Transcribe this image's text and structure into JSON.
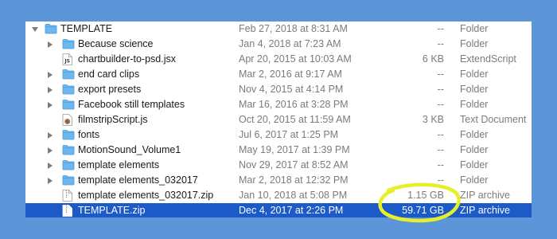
{
  "colors": {
    "background": "#5c96d8",
    "selection": "#1c5ac8",
    "folder": "#6cb7ee",
    "highlight_ring": "#e7ef2a"
  },
  "rows": [
    {
      "name": "TEMPLATE",
      "date": "Feb 27, 2018 at 8:31 AM",
      "size": "--",
      "kind": "Folder",
      "icon": "folder-icon",
      "disclosure": "open"
    },
    {
      "name": "Because science",
      "date": "Jan 4, 2018 at 7:23 AM",
      "size": "--",
      "kind": "Folder",
      "icon": "folder-icon",
      "disclosure": "closed"
    },
    {
      "name": "chartbuilder-to-psd.jsx",
      "date": "Apr 20, 2015 at 10:03 AM",
      "size": "6 KB",
      "kind": "ExtendScript",
      "icon": "script-file-icon",
      "disclosure": "none"
    },
    {
      "name": "end card clips",
      "date": "Mar 2, 2016 at 9:17 AM",
      "size": "--",
      "kind": "Folder",
      "icon": "folder-icon",
      "disclosure": "closed"
    },
    {
      "name": "export presets",
      "date": "Nov 4, 2015 at 4:14 PM",
      "size": "--",
      "kind": "Folder",
      "icon": "folder-icon",
      "disclosure": "closed"
    },
    {
      "name": "Facebook still templates",
      "date": "Mar 16, 2016 at 3:28 PM",
      "size": "--",
      "kind": "Folder",
      "icon": "folder-icon",
      "disclosure": "closed"
    },
    {
      "name": "filmstripScript.js",
      "date": "Oct 20, 2015 at 11:59 AM",
      "size": "3 KB",
      "kind": "Text Document",
      "icon": "js-file-icon",
      "disclosure": "none"
    },
    {
      "name": "fonts",
      "date": "Jul 6, 2017 at 1:25 PM",
      "size": "--",
      "kind": "Folder",
      "icon": "folder-icon",
      "disclosure": "closed"
    },
    {
      "name": "MotionSound_Volume1",
      "date": "May 19, 2017 at 1:39 PM",
      "size": "--",
      "kind": "Folder",
      "icon": "folder-icon",
      "disclosure": "closed"
    },
    {
      "name": "template elements",
      "date": "Nov 29, 2017 at 8:52 AM",
      "size": "--",
      "kind": "Folder",
      "icon": "folder-icon",
      "disclosure": "closed"
    },
    {
      "name": "template elements_032017",
      "date": "Mar 2, 2018 at 12:32 PM",
      "size": "--",
      "kind": "Folder",
      "icon": "folder-icon",
      "disclosure": "closed"
    },
    {
      "name": "template elements_032017.zip",
      "date": "Jan 10, 2018 at 5:08 PM",
      "size": "1.15 GB",
      "kind": "ZIP archive",
      "icon": "zip-file-icon",
      "disclosure": "none"
    },
    {
      "name": "TEMPLATE.zip",
      "date": "Dec 4, 2017 at 2:26 PM",
      "size": "59.71 GB",
      "kind": "ZIP archive",
      "icon": "zip-file-icon",
      "disclosure": "none",
      "selected": true
    }
  ]
}
